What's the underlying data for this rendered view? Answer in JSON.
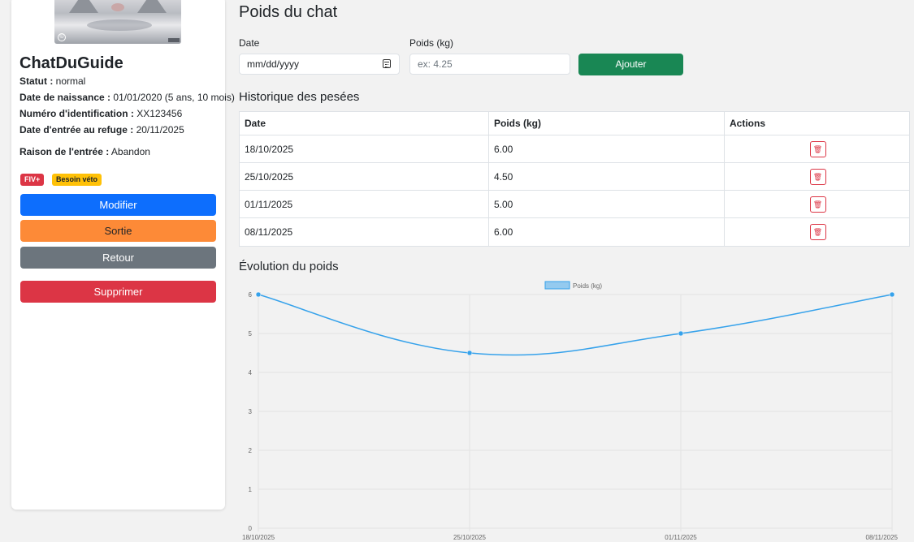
{
  "sidebar": {
    "cat_name": "ChatDuGuide",
    "status_label": "Statut :",
    "status_value": "normal",
    "birth_label": "Date de naissance :",
    "birth_value": "01/01/2020 (5 ans, 10 mois)",
    "id_label": "Numéro d'identification :",
    "id_value": "XX123456",
    "entry_label": "Date d'entrée au refuge :",
    "entry_value": "20/11/2025",
    "reason_label": "Raison de l'entrée :",
    "reason_value": "Abandon",
    "badges": [
      "FIV+",
      "Besoin véto"
    ],
    "buttons": {
      "modify": "Modifier",
      "exit": "Sortie",
      "back": "Retour",
      "delete": "Supprimer"
    },
    "colors": {
      "primary": "#0d6efd",
      "orange": "#fd8a37",
      "secondary": "#6c757d",
      "danger": "#dc3545",
      "warning": "#ffc107"
    }
  },
  "main": {
    "title": "Poids du chat",
    "form": {
      "date_label": "Date",
      "date_placeholder": "mm/dd/yyyy",
      "weight_label": "Poids (kg)",
      "weight_placeholder": "ex: 4.25",
      "add_button": "Ajouter",
      "add_color": "#198754"
    },
    "history_title": "Historique des pesées",
    "table": {
      "headers": [
        "Date",
        "Poids (kg)",
        "Actions"
      ],
      "rows": [
        {
          "date": "18/10/2025",
          "weight": "6.00",
          "action_icon": "trash-icon"
        },
        {
          "date": "25/10/2025",
          "weight": "4.50",
          "action_icon": "trash-icon"
        },
        {
          "date": "01/11/2025",
          "weight": "5.00",
          "action_icon": "trash-icon"
        },
        {
          "date": "08/11/2025",
          "weight": "6.00",
          "action_icon": "trash-icon"
        }
      ]
    },
    "chart_title": "Évolution du poids"
  },
  "chart_data": {
    "type": "line",
    "categories": [
      "18/10/2025",
      "25/10/2025",
      "01/11/2025",
      "08/11/2025"
    ],
    "series": [
      {
        "name": "Poids (kg)",
        "values": [
          6,
          4.5,
          5,
          6
        ],
        "color": "#36a2eb"
      }
    ],
    "ylim": [
      0,
      6
    ],
    "yticks": [
      0,
      1,
      2,
      3,
      4,
      5,
      6
    ],
    "grid": true,
    "legend": "top-center"
  }
}
